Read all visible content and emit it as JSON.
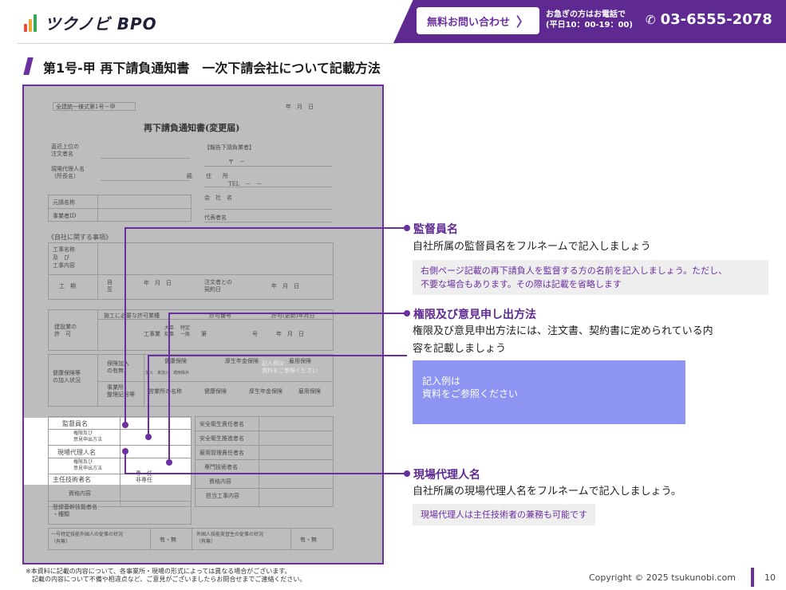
{
  "header": {
    "logo_text": "ツクノビ BPO",
    "contact_button": "無料お問い合わせ",
    "contact_note_line1": "お急ぎの方はお電話で",
    "contact_note_line2": "(平日10：00-19：00)",
    "phone": "03-6555-2078"
  },
  "page_title": "第1号-甲 再下請負通知書　一次下請会社について記載方法",
  "form": {
    "top_label": "全建統一様式第1号－甲",
    "date": "年　月　日",
    "doc_title": "再下請負通知書(変更届)",
    "report_label": "【報告下請負業者】",
    "upper_orderer": "直近上位の\n注文者名",
    "site_agent_name": "現場代理人名\n（所長名）",
    "dono": "殿",
    "address": "住　　所",
    "zip": "〒　－",
    "tel": "TEL　－　－",
    "prime_name": "元請名称",
    "business_id": "事業者ID",
    "company_name": "会　社　名",
    "company_id": "事業者ID",
    "representative": "代表者名",
    "own_company_header": "《自社に関する事項》",
    "work_name": "工事名称\n及　び\n工事内容",
    "period": "工　期",
    "from_to": "自\n至",
    "ymd": "年　月　日",
    "contract_date": "注文者との\n契約日",
    "license_header": "施工に必要な許可業種",
    "permit_no": "許可番号",
    "permit_date": "許可(更新)年月日",
    "construction_license": "建設業の\n許　可",
    "kouji": "工事業",
    "minister": "大臣\n知事",
    "special": "特定\n一般",
    "dai": "第",
    "gou": "号",
    "insurance_status": "健康保険等\nの加入状況",
    "insurance_enroll": "保険加入\nの有無",
    "health": "健康保険",
    "pension": "厚生年金保険",
    "employment": "雇用保険",
    "enroll_options": "加入　未加入　適用除外",
    "office_label": "事業所\n整理記号等",
    "office_name": "営業所の名称",
    "supervisor": "監督員名",
    "authority1": "権限及び\n意見申出方法",
    "site_agent": "現場代理人名",
    "authority2": "権限及び\n意見申出方法",
    "chief_engineer": "主任技術者名",
    "full_time": "専　任\n非専任",
    "qualification": "資格内容",
    "safety_manager": "安全衛生責任者名",
    "safety_promoter": "安全衛生推進者名",
    "employment_manager": "雇用管理責任者名",
    "specialist_engineer": "専門技術者名",
    "qualification2": "資格内容",
    "assigned_work": "担当工事内容",
    "core_engineer": "登録基幹技能者名\n・種類",
    "foreign_specified": "一号特定技能外国人の従事の状況\n（有無）",
    "foreign_trainee": "外国人技能実習生の従事の状況\n（有無）",
    "yes_no": "有・無",
    "stamp": "記入例は\n資料をご参照ください"
  },
  "annotations": [
    {
      "title": "監督員名",
      "desc": "自社所属の監督員名をフルネームで記入しましょう",
      "note": "右側ページ記載の再下請負人を監督する方の名前を記入しましょう。ただし、\n不要な場合もあります。その際は記載を省略します"
    },
    {
      "title": "権限及び意見申し出方法",
      "desc": "権限及び意見申出方法には、注文書、契約書に定められている内\n容を記載しましょう",
      "example": "記入例は\n資料をご参照ください"
    },
    {
      "title": "現場代理人名",
      "desc": "自社所属の現場代理人名をフルネームで記入しましょう。",
      "note": "現場代理人は主任技術者の兼務も可能です"
    }
  ],
  "footer": {
    "footnote_line1": "※本資料に記載の内容について、各事業所・現場の形式によっては異なる場合がございます。",
    "footnote_line2": "　記載の内容について不備や相違点など、ご意見がございましたらお問合せまでご連絡ください。",
    "copyright": "Copyright © 2025 tsukunobi.com",
    "page_number": "10"
  },
  "colors": {
    "brand_purple": "#6b2fa0",
    "example_blue": "#8d94f2",
    "note_gray": "#eeeeee"
  }
}
